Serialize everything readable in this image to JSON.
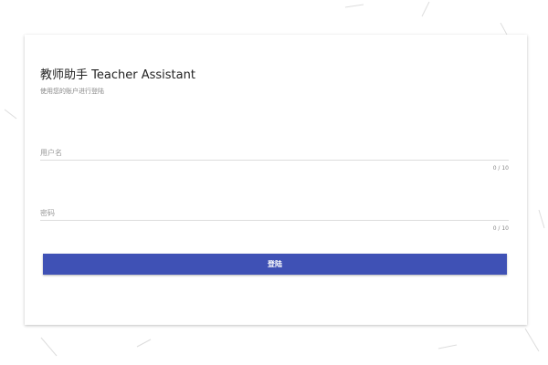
{
  "header": {
    "title": "教师助手 Teacher Assistant",
    "subtitle": "使用您的账户进行登陆"
  },
  "form": {
    "username": {
      "placeholder": "用户名",
      "value": "",
      "counter": "0 / 10"
    },
    "password": {
      "placeholder": "密码",
      "value": "",
      "counter": "0 / 10"
    },
    "login_label": "登陆"
  },
  "colors": {
    "primary": "#3f51b5"
  }
}
